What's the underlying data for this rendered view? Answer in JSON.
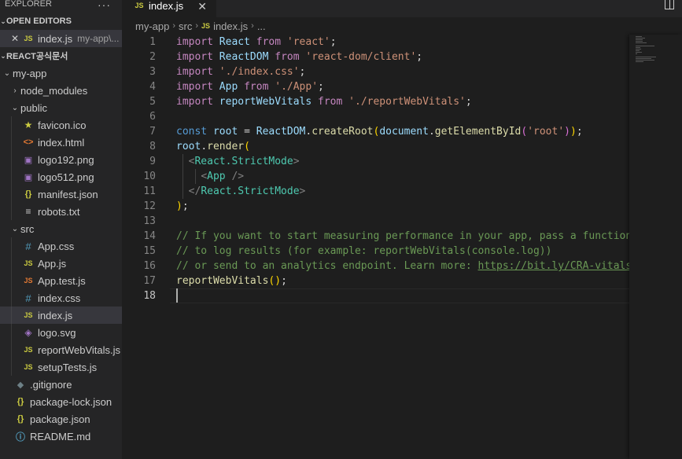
{
  "sidebar": {
    "title": "EXPLORER",
    "more_icon": "more-icon",
    "open_editors_label": "OPEN EDITORS",
    "open_editor": {
      "name": "index.js",
      "path": "my-app\\..."
    },
    "workspace_label": "REACT공식문서",
    "tree": [
      {
        "label": "my-app",
        "type": "folder-open",
        "indent": 0
      },
      {
        "label": "node_modules",
        "type": "folder-closed",
        "indent": 1
      },
      {
        "label": "public",
        "type": "folder-open",
        "indent": 1
      },
      {
        "label": "favicon.ico",
        "type": "star",
        "indent": 2
      },
      {
        "label": "index.html",
        "type": "html",
        "indent": 2
      },
      {
        "label": "logo192.png",
        "type": "img",
        "indent": 2
      },
      {
        "label": "logo512.png",
        "type": "img",
        "indent": 2
      },
      {
        "label": "manifest.json",
        "type": "json",
        "indent": 2
      },
      {
        "label": "robots.txt",
        "type": "txt",
        "indent": 2
      },
      {
        "label": "src",
        "type": "folder-open",
        "indent": 1
      },
      {
        "label": "App.css",
        "type": "css",
        "indent": 2
      },
      {
        "label": "App.js",
        "type": "js",
        "indent": 2
      },
      {
        "label": "App.test.js",
        "type": "js-test",
        "indent": 2
      },
      {
        "label": "index.css",
        "type": "css",
        "indent": 2
      },
      {
        "label": "index.js",
        "type": "js",
        "indent": 2,
        "selected": true
      },
      {
        "label": "logo.svg",
        "type": "svg",
        "indent": 2
      },
      {
        "label": "reportWebVitals.js",
        "type": "js",
        "indent": 2
      },
      {
        "label": "setupTests.js",
        "type": "js",
        "indent": 2
      },
      {
        "label": ".gitignore",
        "type": "git",
        "indent": 1
      },
      {
        "label": "package-lock.json",
        "type": "json",
        "indent": 1
      },
      {
        "label": "package.json",
        "type": "json",
        "indent": 1
      },
      {
        "label": "README.md",
        "type": "info",
        "indent": 1
      }
    ]
  },
  "tab": {
    "name": "index.js",
    "badge": "JS"
  },
  "breadcrumb": {
    "parts": [
      "my-app",
      "src",
      "index.js",
      "..."
    ]
  },
  "code": {
    "active_line": 18,
    "line_numbers": [
      "1",
      "2",
      "3",
      "4",
      "5",
      "6",
      "7",
      "8",
      "9",
      "10",
      "11",
      "12",
      "13",
      "14",
      "15",
      "16",
      "17",
      "18"
    ]
  },
  "colors": {
    "background": "#1e1e1e",
    "sidebar": "#252526",
    "selected_row": "#37373d",
    "keyword": "#c586c0",
    "string": "#ce9178",
    "comment": "#6a9955",
    "function": "#dcdcaa",
    "variable": "#9cdcfe",
    "class": "#4ec9b0"
  }
}
